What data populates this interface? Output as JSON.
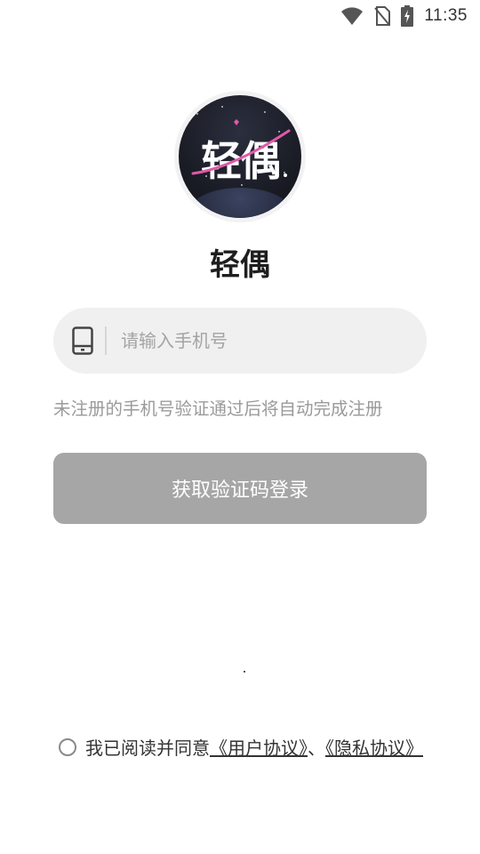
{
  "status_bar": {
    "time": "11:35",
    "icons": [
      "wifi-icon",
      "no-sim-icon",
      "battery-charging-icon"
    ]
  },
  "logo": {
    "text": "轻偶"
  },
  "app": {
    "title": "轻偶"
  },
  "phone": {
    "placeholder": "请输入手机号",
    "value": ""
  },
  "hint": "未注册的手机号验证通过后将自动完成注册",
  "login_button": "获取验证码登录",
  "agreement": {
    "prefix": "我已阅读并同意",
    "user_agreement": "《用户协议》",
    "separator": "、",
    "privacy_policy": "《隐私协议》"
  },
  "colors": {
    "button_disabled": "#a6a6a6",
    "input_bg": "#f0f0f0",
    "hint_text": "#9a9a9a",
    "orbit_accent": "#e05aa8"
  }
}
